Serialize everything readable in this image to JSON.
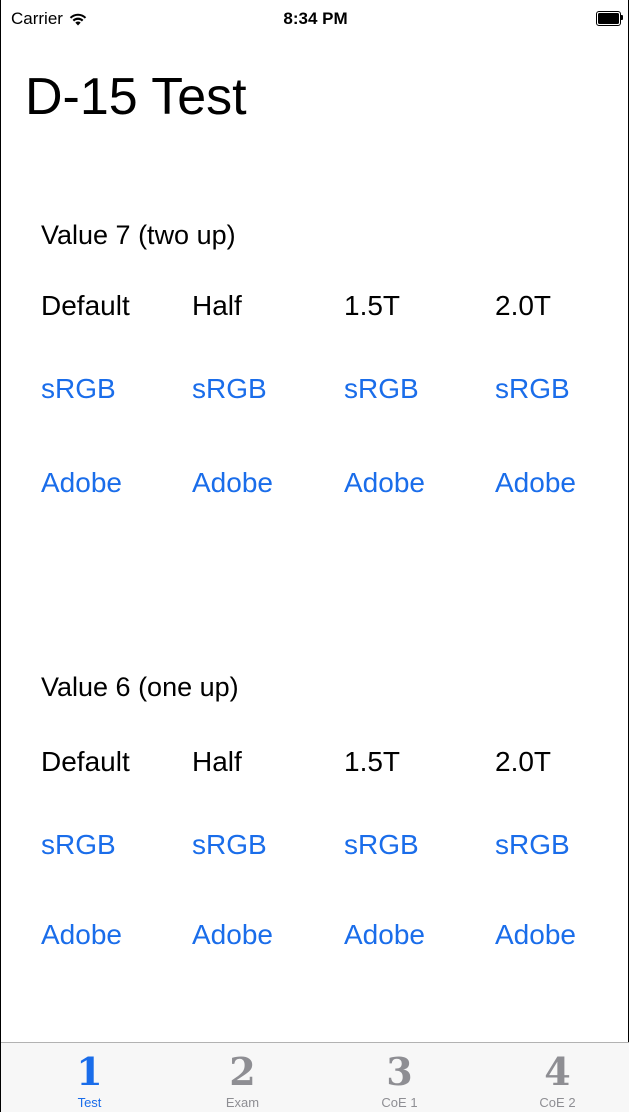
{
  "status_bar": {
    "carrier": "Carrier",
    "time": "8:34 PM",
    "wifi_icon": "wifi-icon",
    "battery_icon": "battery-full-icon"
  },
  "page": {
    "title": "D-15 Test"
  },
  "sections": [
    {
      "heading": "Value 7 (two up)",
      "columns": [
        "Default",
        "Half",
        "1.5T",
        "2.0T"
      ],
      "srgb": [
        "sRGB",
        "sRGB",
        "sRGB",
        "sRGB"
      ],
      "adobe": [
        "Adobe",
        "Adobe",
        "Adobe",
        "Adobe"
      ]
    },
    {
      "heading": "Value 6 (one up)",
      "columns": [
        "Default",
        "Half",
        "1.5T",
        "2.0T"
      ],
      "srgb": [
        "sRGB",
        "sRGB",
        "sRGB",
        "sRGB"
      ],
      "adobe": [
        "Adobe",
        "Adobe",
        "Adobe",
        "Adobe"
      ]
    }
  ],
  "tab_bar": {
    "selected": "Test",
    "tabs": [
      {
        "glyph": "1",
        "label": "Test"
      },
      {
        "glyph": "2",
        "label": "Exam"
      },
      {
        "glyph": "3",
        "label": "CoE 1"
      },
      {
        "glyph": "4",
        "label": "CoE 2"
      }
    ]
  },
  "colors": {
    "link": "#1a6dea",
    "tab_inactive": "#8e8e93",
    "tab_bar_bg": "#f7f7f7"
  }
}
